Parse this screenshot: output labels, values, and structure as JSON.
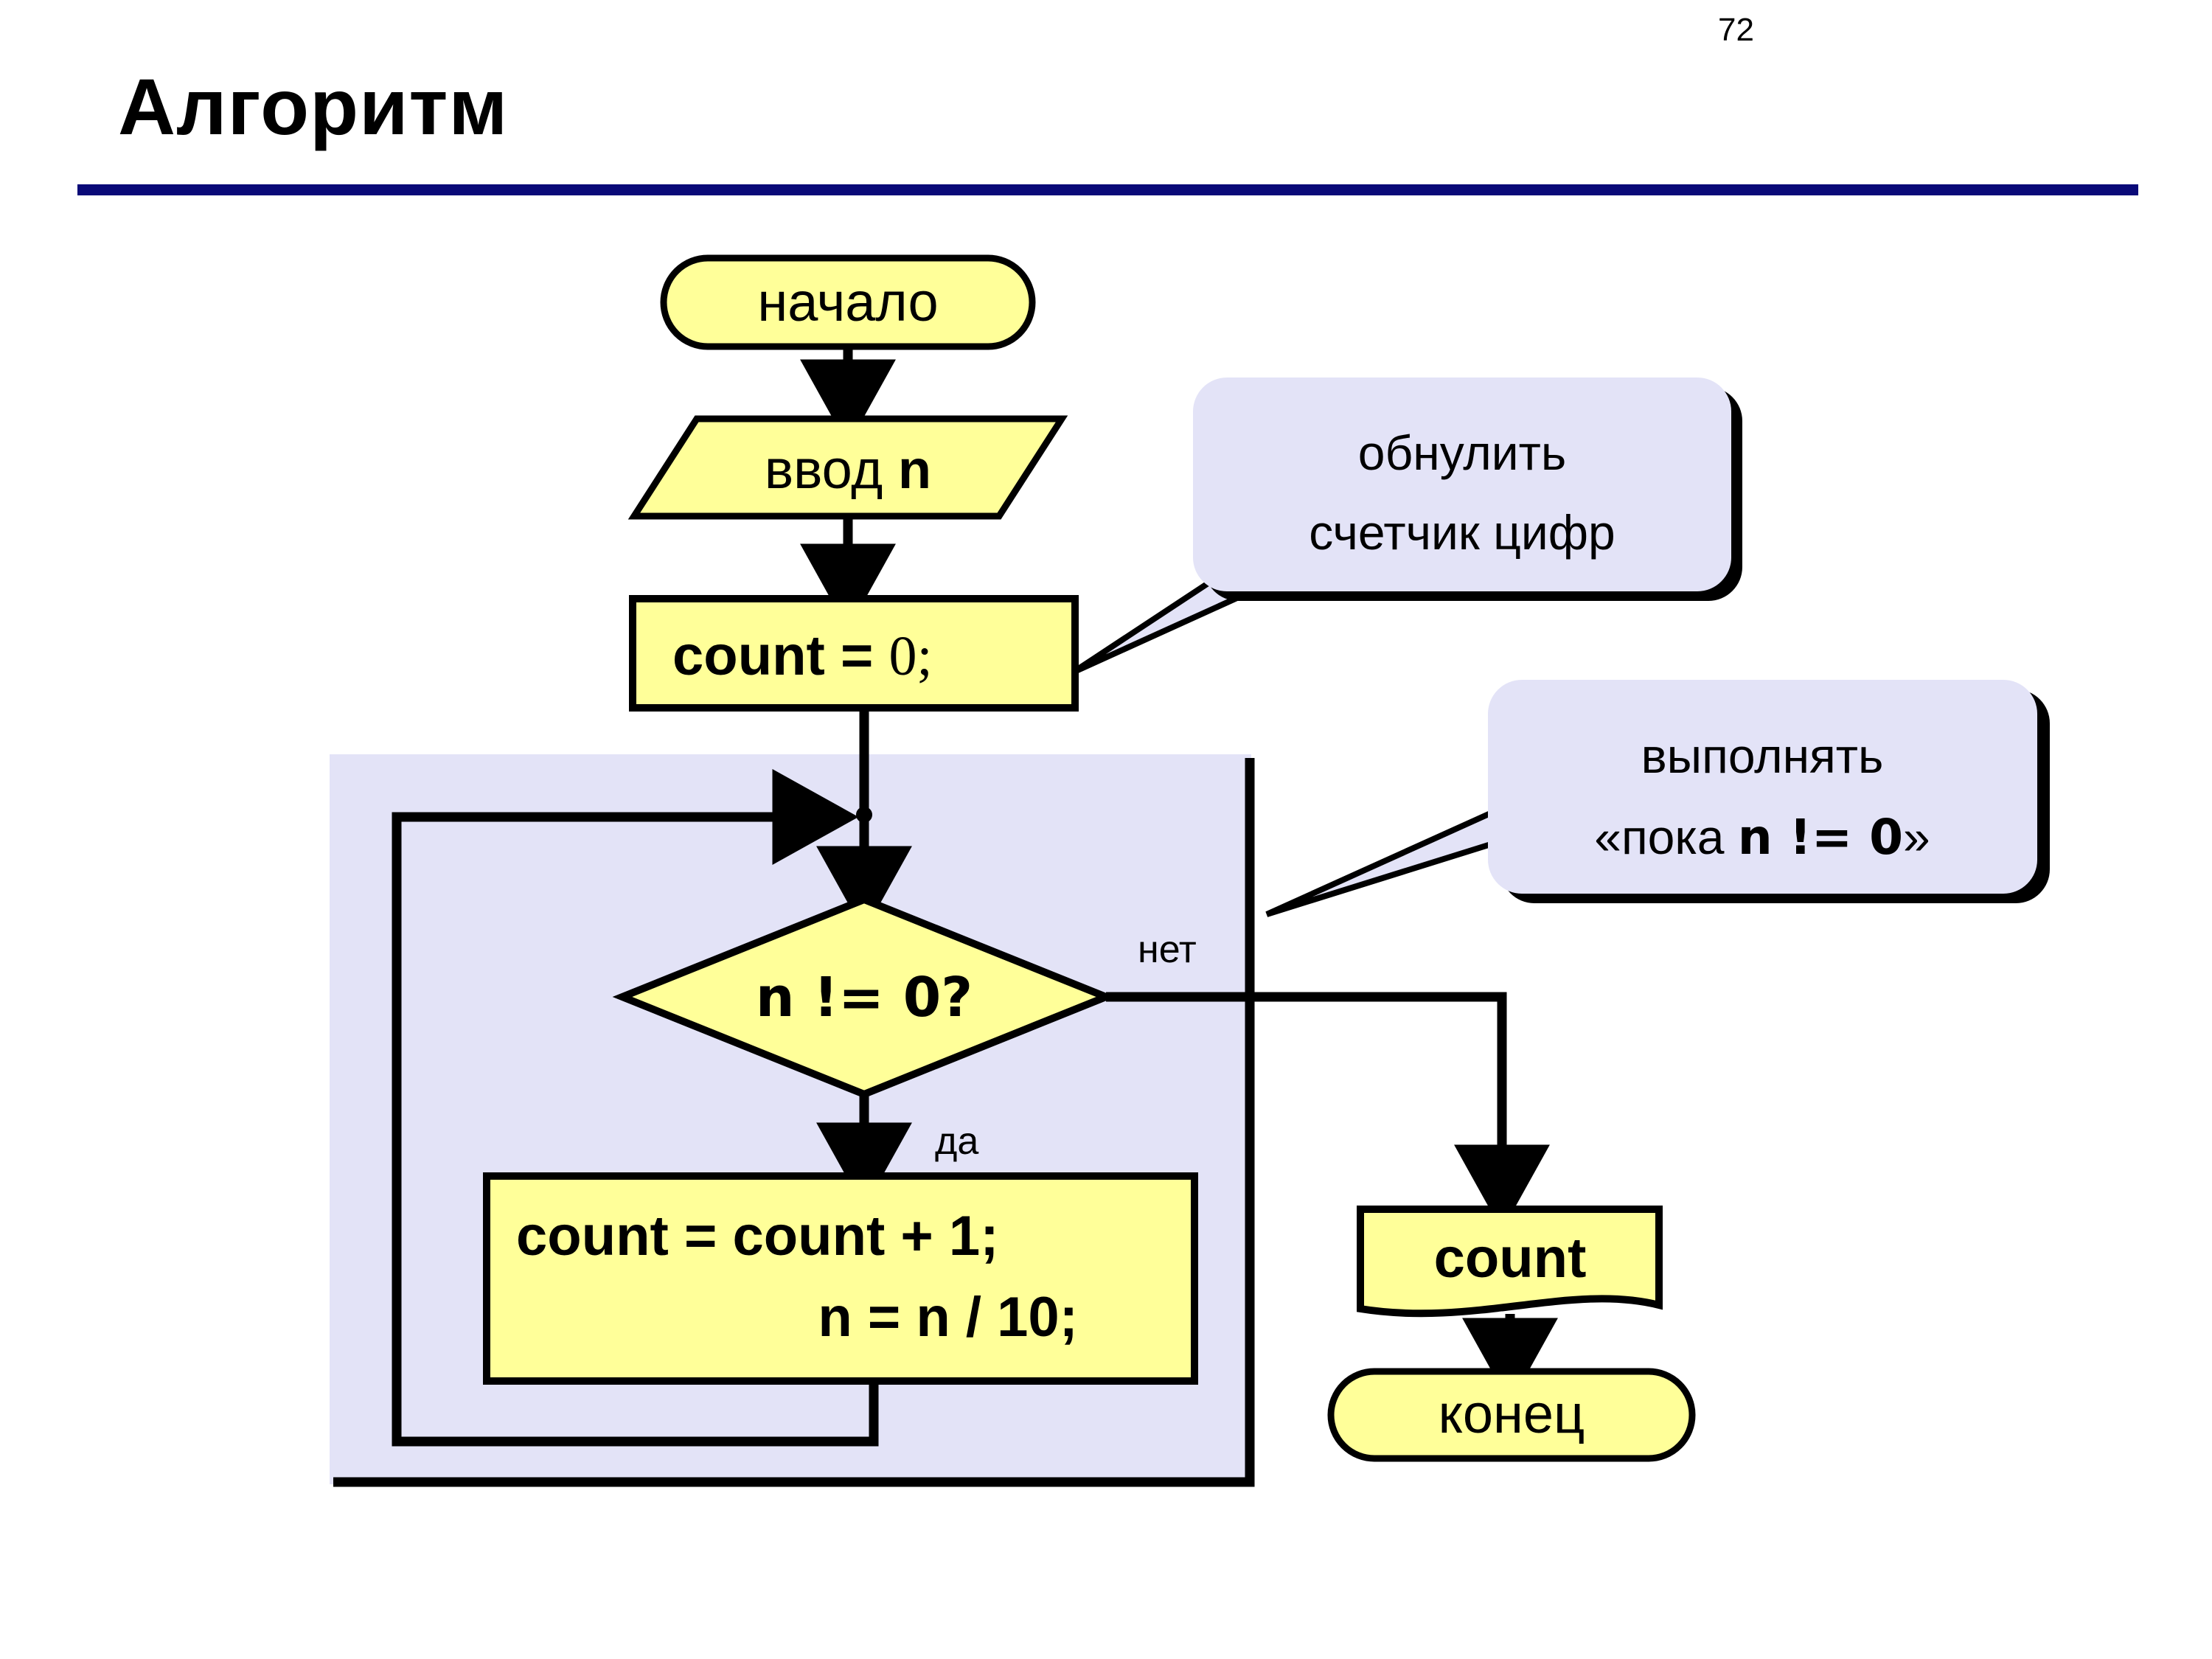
{
  "slide": {
    "page_number": "72",
    "title": "Алгоритм",
    "rule_color": "#0a0a78"
  },
  "colors": {
    "node_fill": "#ffff99",
    "node_stroke": "#000000",
    "loop_region_fill": "#e3e3f7",
    "callout_fill": "#e3e3f7",
    "callout_stroke": "#000000",
    "title_rule": "#0a0a78",
    "text": "#000000"
  },
  "flowchart": {
    "type": "flowchart",
    "nodes": [
      {
        "id": "start",
        "shape": "terminator",
        "label": "начало"
      },
      {
        "id": "input",
        "shape": "parallelogram",
        "label_plain": "ввод ",
        "label_bold": "n"
      },
      {
        "id": "init",
        "shape": "process",
        "label_bold": "count = ",
        "label_plain": "0;"
      },
      {
        "id": "cond",
        "shape": "decision",
        "label": "n != 0?"
      },
      {
        "id": "body",
        "shape": "process",
        "line1": "count = count + 1;",
        "line2": "n = n / 10;"
      },
      {
        "id": "output",
        "shape": "document",
        "label": "count"
      },
      {
        "id": "end",
        "shape": "terminator",
        "label": "конец"
      }
    ],
    "edges": [
      {
        "from": "start",
        "to": "input",
        "label": ""
      },
      {
        "from": "input",
        "to": "init",
        "label": ""
      },
      {
        "from": "init",
        "to": "cond",
        "label": ""
      },
      {
        "from": "cond",
        "to": "body",
        "label": "да"
      },
      {
        "from": "cond",
        "to": "output",
        "label": "нет"
      },
      {
        "from": "body",
        "to": "cond",
        "label": ""
      },
      {
        "from": "output",
        "to": "end",
        "label": ""
      }
    ],
    "branch_labels": {
      "yes": "да",
      "no": "нет"
    }
  },
  "callouts": [
    {
      "id": "callout-init",
      "line1": "обнулить",
      "line2": "счетчик цифр",
      "points_to": "init"
    },
    {
      "id": "callout-loop",
      "line1": "выполнять",
      "line2_pre": "«пока ",
      "line2_code": "n != 0",
      "line2_post": "»",
      "points_to": "loop-region"
    }
  ]
}
